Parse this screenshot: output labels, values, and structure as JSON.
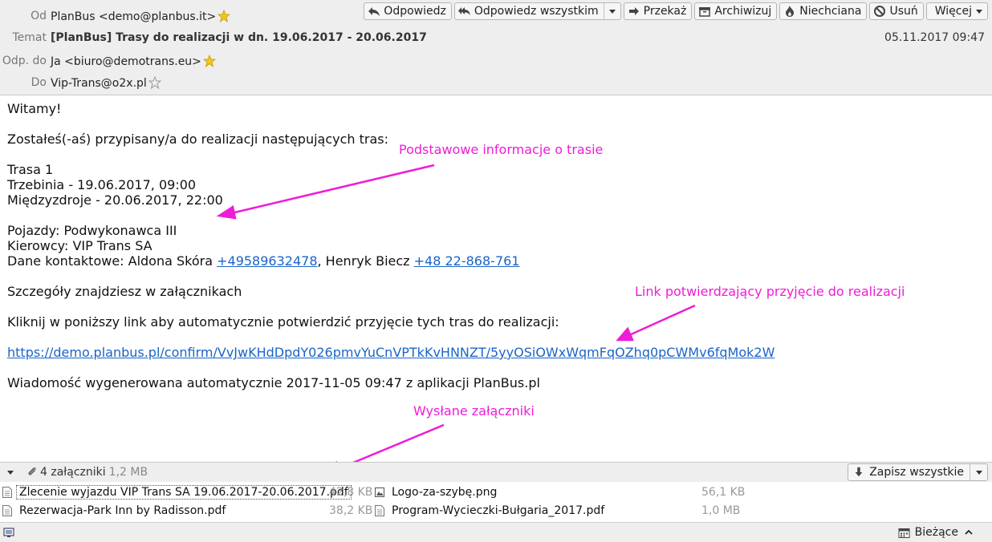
{
  "header": {
    "from_label": "Od",
    "from_value": "PlanBus <demo@planbus.it>",
    "subject_label": "Temat",
    "subject_value": "[PlanBus] Trasy do realizacji w dn. 19.06.2017 - 20.06.2017",
    "reply_to_label": "Odp. do",
    "reply_to_value": "Ja <biuro@demotrans.eu>",
    "to_label": "Do",
    "to_value": "Vip-Trans@o2x.pl",
    "date": "05.11.2017 09:47"
  },
  "toolbar": {
    "reply": "Odpowiedz",
    "reply_all": "Odpowiedz wszystkim",
    "forward": "Przekaż",
    "archive": "Archiwizuj",
    "junk": "Niechciana",
    "delete": "Usuń",
    "more": "Więcej"
  },
  "message": {
    "greeting": "Witamy!",
    "intro": "Zostałeś(-aś) przypisany/a do realizacji następujących tras:",
    "route_title": "Trasa 1",
    "route_from": "Trzebinia - 19.06.2017, 09:00",
    "route_to": "Międzyzdroje - 20.06.2017, 22:00",
    "vehicles": "Pojazdy: Podwykonawca III",
    "drivers": "Kierowcy: VIP Trans SA",
    "contact_prefix": "Dane kontaktowe: Aldona Skóra ",
    "phone1": "+49589632478",
    "contact_mid": ", Henryk Biecz ",
    "phone2": "+48 22-868-761",
    "details": "Szczegóły znajdziesz w załącznikach",
    "confirm_text": "Kliknij w poniższy link aby automatycznie potwierdzić przyjęcie tych tras do realizacji:",
    "confirm_link": "https://demo.planbus.pl/confirm/VvJwKHdDpdY026pmvYuCnVPTkKvHNNZT/5yyOSiOWxWqmFqOZhq0pCWMv6fqMok2W",
    "footer": "Wiadomość wygenerowana automatycznie 2017-11-05 09:47 z aplikacji PlanBus.pl"
  },
  "annotations": {
    "route_info": "Podstawowe informacje o trasie",
    "confirm_link": "Link potwierdzający przyjęcie do realizacji",
    "attachments": "Wysłane załączniki"
  },
  "attachments_bar": {
    "count": "4 załączniki",
    "size": "1,2 MB",
    "save_all": "Zapisz wszystkie"
  },
  "attachments": [
    {
      "name": "Zlecenie wyjazdu VIP Trans SA 19.06.2017-20.06.2017.pdf",
      "size": "42,8 KB",
      "icon": "pdf-file-icon"
    },
    {
      "name": "Logo-za-szybę.png",
      "size": "56,1 KB",
      "icon": "image-file-icon"
    },
    {
      "name": "Rezerwacja-Park Inn by Radisson.pdf",
      "size": "38,2 KB",
      "icon": "pdf-file-icon"
    },
    {
      "name": "Program-Wycieczki-Bułgaria_2017.pdf",
      "size": "1,0 MB",
      "icon": "pdf-file-icon"
    }
  ],
  "statusbar": {
    "today": "Bieżące"
  },
  "colors": {
    "annotation": "#ee1cd6",
    "link": "#1a64c8",
    "header_bg": "#eeeeee"
  }
}
